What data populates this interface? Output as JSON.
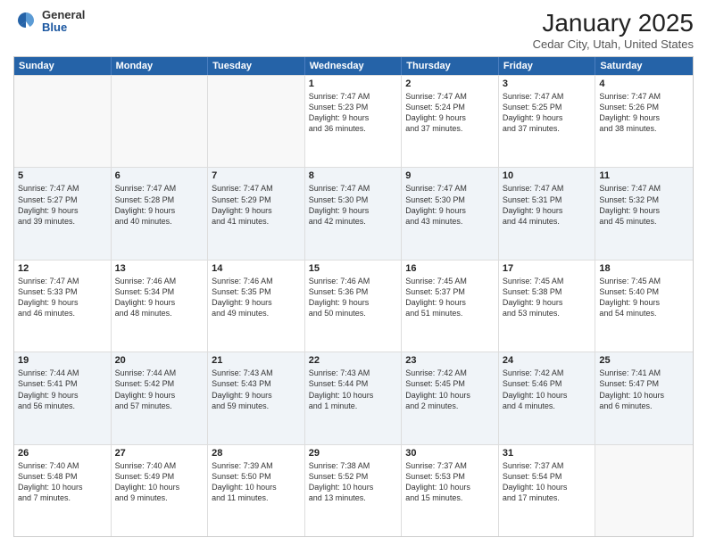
{
  "logo": {
    "general": "General",
    "blue": "Blue"
  },
  "title": "January 2025",
  "subtitle": "Cedar City, Utah, United States",
  "days_of_week": [
    "Sunday",
    "Monday",
    "Tuesday",
    "Wednesday",
    "Thursday",
    "Friday",
    "Saturday"
  ],
  "weeks": [
    [
      {
        "day": "",
        "info": ""
      },
      {
        "day": "",
        "info": ""
      },
      {
        "day": "",
        "info": ""
      },
      {
        "day": "1",
        "info": "Sunrise: 7:47 AM\nSunset: 5:23 PM\nDaylight: 9 hours\nand 36 minutes."
      },
      {
        "day": "2",
        "info": "Sunrise: 7:47 AM\nSunset: 5:24 PM\nDaylight: 9 hours\nand 37 minutes."
      },
      {
        "day": "3",
        "info": "Sunrise: 7:47 AM\nSunset: 5:25 PM\nDaylight: 9 hours\nand 37 minutes."
      },
      {
        "day": "4",
        "info": "Sunrise: 7:47 AM\nSunset: 5:26 PM\nDaylight: 9 hours\nand 38 minutes."
      }
    ],
    [
      {
        "day": "5",
        "info": "Sunrise: 7:47 AM\nSunset: 5:27 PM\nDaylight: 9 hours\nand 39 minutes."
      },
      {
        "day": "6",
        "info": "Sunrise: 7:47 AM\nSunset: 5:28 PM\nDaylight: 9 hours\nand 40 minutes."
      },
      {
        "day": "7",
        "info": "Sunrise: 7:47 AM\nSunset: 5:29 PM\nDaylight: 9 hours\nand 41 minutes."
      },
      {
        "day": "8",
        "info": "Sunrise: 7:47 AM\nSunset: 5:30 PM\nDaylight: 9 hours\nand 42 minutes."
      },
      {
        "day": "9",
        "info": "Sunrise: 7:47 AM\nSunset: 5:30 PM\nDaylight: 9 hours\nand 43 minutes."
      },
      {
        "day": "10",
        "info": "Sunrise: 7:47 AM\nSunset: 5:31 PM\nDaylight: 9 hours\nand 44 minutes."
      },
      {
        "day": "11",
        "info": "Sunrise: 7:47 AM\nSunset: 5:32 PM\nDaylight: 9 hours\nand 45 minutes."
      }
    ],
    [
      {
        "day": "12",
        "info": "Sunrise: 7:47 AM\nSunset: 5:33 PM\nDaylight: 9 hours\nand 46 minutes."
      },
      {
        "day": "13",
        "info": "Sunrise: 7:46 AM\nSunset: 5:34 PM\nDaylight: 9 hours\nand 48 minutes."
      },
      {
        "day": "14",
        "info": "Sunrise: 7:46 AM\nSunset: 5:35 PM\nDaylight: 9 hours\nand 49 minutes."
      },
      {
        "day": "15",
        "info": "Sunrise: 7:46 AM\nSunset: 5:36 PM\nDaylight: 9 hours\nand 50 minutes."
      },
      {
        "day": "16",
        "info": "Sunrise: 7:45 AM\nSunset: 5:37 PM\nDaylight: 9 hours\nand 51 minutes."
      },
      {
        "day": "17",
        "info": "Sunrise: 7:45 AM\nSunset: 5:38 PM\nDaylight: 9 hours\nand 53 minutes."
      },
      {
        "day": "18",
        "info": "Sunrise: 7:45 AM\nSunset: 5:40 PM\nDaylight: 9 hours\nand 54 minutes."
      }
    ],
    [
      {
        "day": "19",
        "info": "Sunrise: 7:44 AM\nSunset: 5:41 PM\nDaylight: 9 hours\nand 56 minutes."
      },
      {
        "day": "20",
        "info": "Sunrise: 7:44 AM\nSunset: 5:42 PM\nDaylight: 9 hours\nand 57 minutes."
      },
      {
        "day": "21",
        "info": "Sunrise: 7:43 AM\nSunset: 5:43 PM\nDaylight: 9 hours\nand 59 minutes."
      },
      {
        "day": "22",
        "info": "Sunrise: 7:43 AM\nSunset: 5:44 PM\nDaylight: 10 hours\nand 1 minute."
      },
      {
        "day": "23",
        "info": "Sunrise: 7:42 AM\nSunset: 5:45 PM\nDaylight: 10 hours\nand 2 minutes."
      },
      {
        "day": "24",
        "info": "Sunrise: 7:42 AM\nSunset: 5:46 PM\nDaylight: 10 hours\nand 4 minutes."
      },
      {
        "day": "25",
        "info": "Sunrise: 7:41 AM\nSunset: 5:47 PM\nDaylight: 10 hours\nand 6 minutes."
      }
    ],
    [
      {
        "day": "26",
        "info": "Sunrise: 7:40 AM\nSunset: 5:48 PM\nDaylight: 10 hours\nand 7 minutes."
      },
      {
        "day": "27",
        "info": "Sunrise: 7:40 AM\nSunset: 5:49 PM\nDaylight: 10 hours\nand 9 minutes."
      },
      {
        "day": "28",
        "info": "Sunrise: 7:39 AM\nSunset: 5:50 PM\nDaylight: 10 hours\nand 11 minutes."
      },
      {
        "day": "29",
        "info": "Sunrise: 7:38 AM\nSunset: 5:52 PM\nDaylight: 10 hours\nand 13 minutes."
      },
      {
        "day": "30",
        "info": "Sunrise: 7:37 AM\nSunset: 5:53 PM\nDaylight: 10 hours\nand 15 minutes."
      },
      {
        "day": "31",
        "info": "Sunrise: 7:37 AM\nSunset: 5:54 PM\nDaylight: 10 hours\nand 17 minutes."
      },
      {
        "day": "",
        "info": ""
      }
    ]
  ]
}
